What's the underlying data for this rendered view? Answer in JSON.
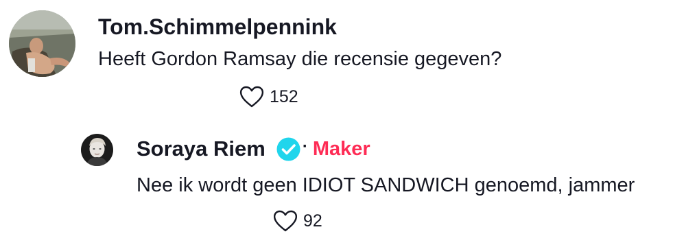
{
  "colors": {
    "text": "#161823",
    "creator_badge": "#fe2c55",
    "verified": "#20d5ec"
  },
  "comment": {
    "username": "Tom.Schimmelpennink",
    "text": "Heeft Gordon Ramsay die recensie gegeven?",
    "like_icon": "heart-outline-icon",
    "likes": "152"
  },
  "reply": {
    "username": "Soraya Riem",
    "verified_icon": "verified-badge-icon",
    "separator": "·",
    "creator_label": "Maker",
    "text": "Nee ik wordt geen IDIOT SANDWICH genoemd, jammer",
    "like_icon": "heart-outline-icon",
    "likes": "92"
  }
}
